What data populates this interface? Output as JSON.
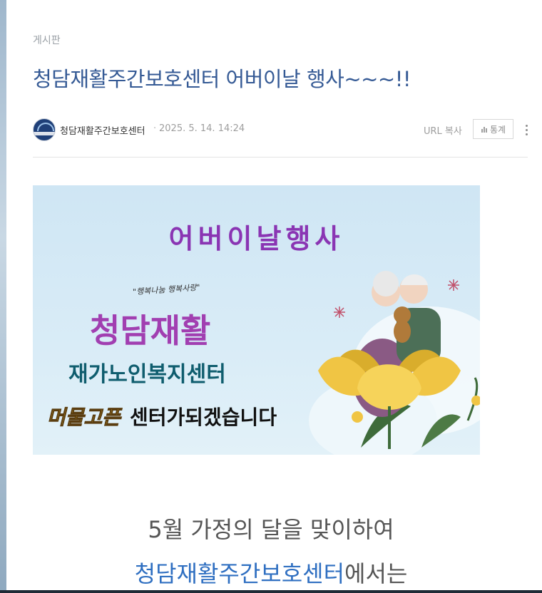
{
  "board_label": "게시판",
  "post": {
    "title": "청담재활주간보호센터 어버이날 행사~~~!!",
    "author": "청담재활주간보호센터",
    "separator": "·",
    "date": "2025. 5. 14. 14:24",
    "url_copy_label": "URL 복사",
    "stats_label": "통계"
  },
  "banner": {
    "event_title": "어버이날행사",
    "slogan": "\"행복나눔 행복사랑\"",
    "center_name": "청담재활",
    "center_sub": "재가노인복지센터",
    "highlight": "머물고픈",
    "message": "센터가되겠습니다"
  },
  "body": {
    "line1": "5월 가정의 달을 맞이하여",
    "line2_center": "청담재활주간보호센터",
    "line2_suffix": "에서는"
  },
  "colors": {
    "title": "#355a95",
    "banner_title": "#8a35b3",
    "link_blue": "#2f6fc1"
  }
}
